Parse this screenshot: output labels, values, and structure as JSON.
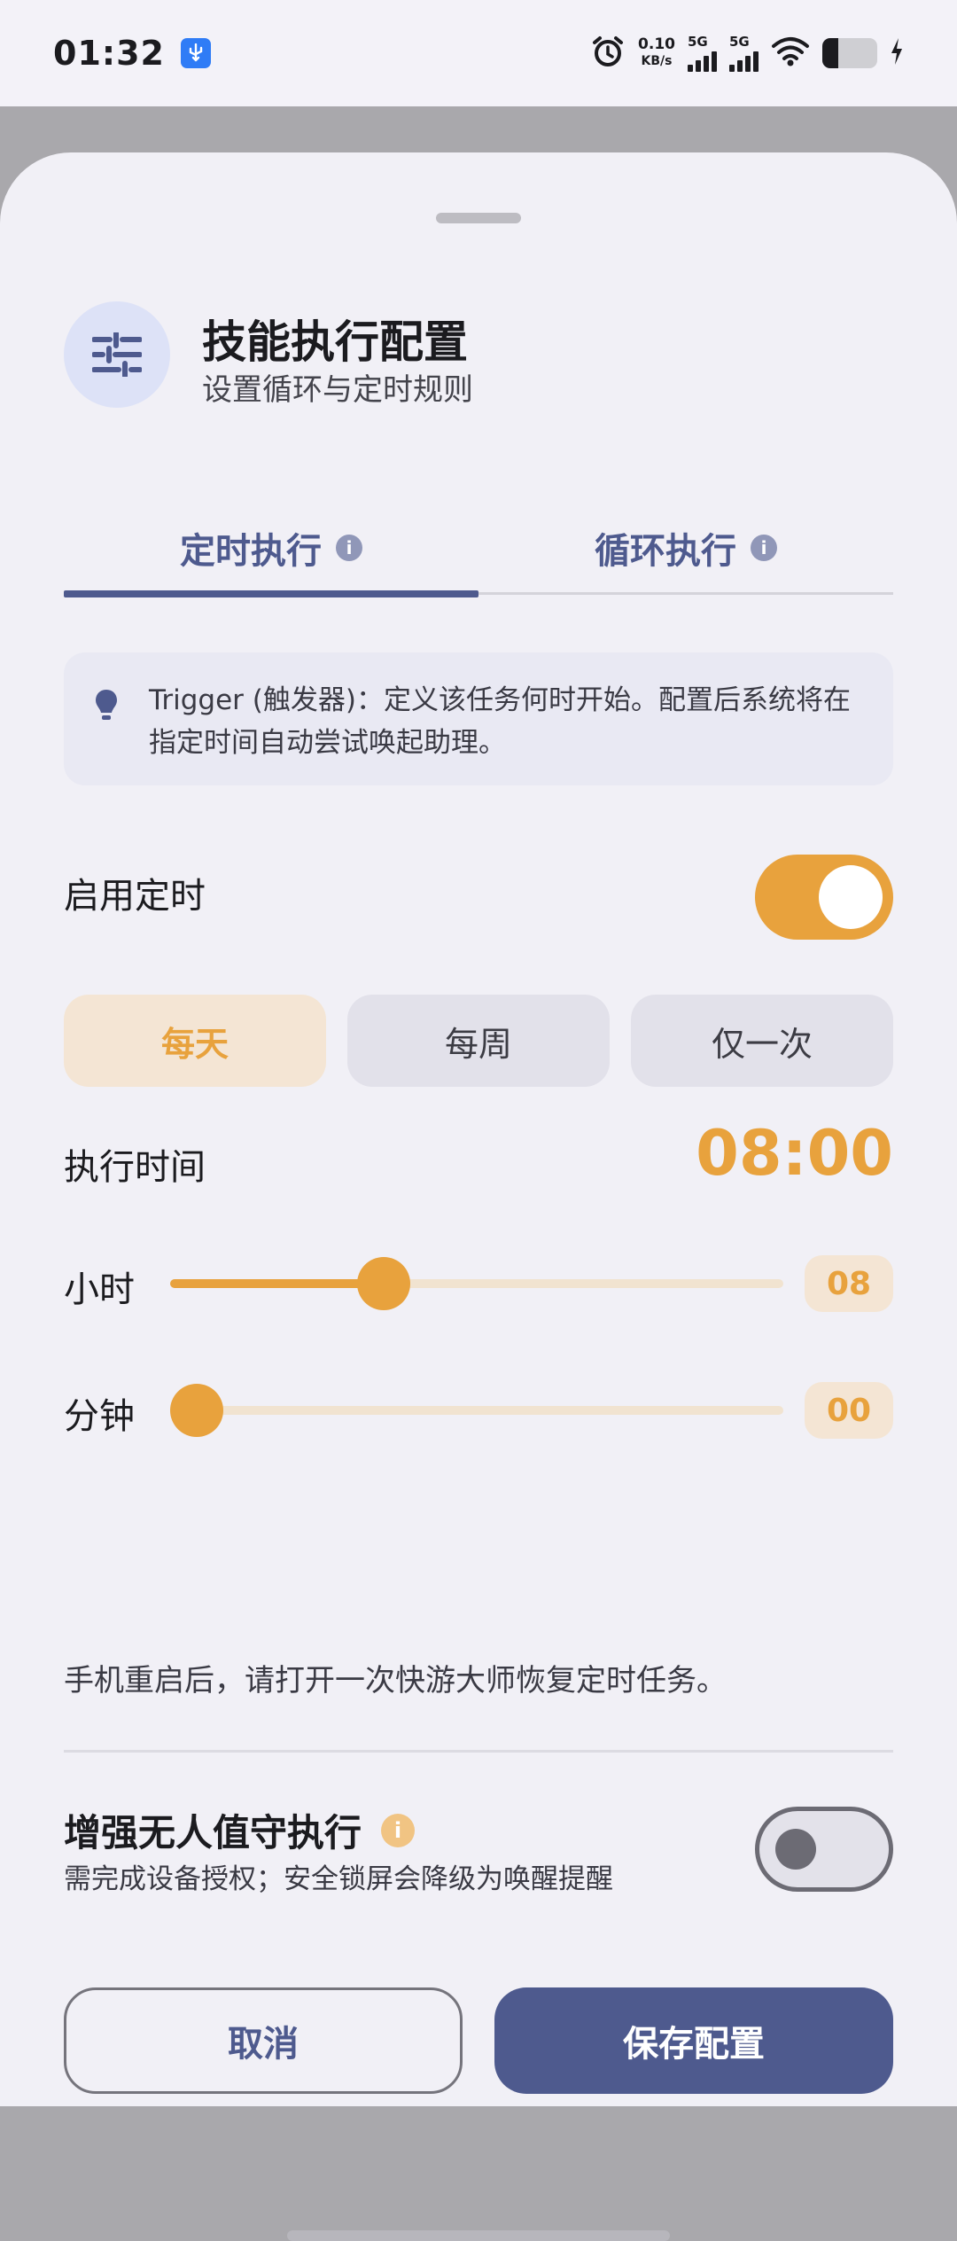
{
  "status_bar": {
    "time": "01:32",
    "net_speed_value": "0.10",
    "net_speed_unit": "KB/s",
    "sim1_label": "5G",
    "sim2_label": "5G"
  },
  "header": {
    "icon": "sliders-icon",
    "title": "技能执行配置",
    "subtitle": "设置循环与定时规则"
  },
  "tabs": [
    {
      "label": "定时执行",
      "active": true
    },
    {
      "label": "循环执行",
      "active": false
    }
  ],
  "tip": {
    "icon": "lightbulb-icon",
    "text": "Trigger (触发器)：定义该任务何时开始。配置后系统将在指定时间自动尝试唤起助理。"
  },
  "enable_schedule": {
    "label": "启用定时",
    "enabled": true
  },
  "frequency": {
    "options": [
      "每天",
      "每周",
      "仅一次"
    ],
    "selected": "每天"
  },
  "execute_time": {
    "label": "执行时间",
    "value": "08:00"
  },
  "hour_slider": {
    "label": "小时",
    "value": "08",
    "fraction": 0.348
  },
  "minute_slider": {
    "label": "分钟",
    "value": "00",
    "fraction": 0.0
  },
  "reboot_note": "手机重启后，请打开一次快游大师恢复定时任务。",
  "unattended": {
    "title": "增强无人值守执行",
    "subtitle": "需完成设备授权；安全锁屏会降级为唤醒提醒",
    "enabled": false
  },
  "buttons": {
    "cancel": "取消",
    "save": "保存配置"
  },
  "colors": {
    "accent": "#e8a23d",
    "primary": "#4e5a8e"
  }
}
